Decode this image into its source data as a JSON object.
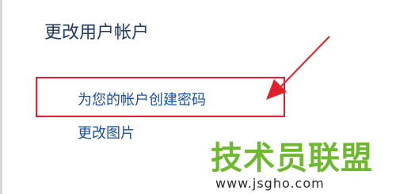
{
  "panel": {
    "title": "更改用户帐户"
  },
  "links": {
    "create_password": "为您的帐户创建密码",
    "change_picture": "更改图片"
  },
  "annotation": {
    "color": "#e0202a",
    "shape": "highlight-box-with-arrow"
  },
  "watermark": {
    "logo_text": "技术员联盟",
    "url": "www.jsgho.com",
    "logo_color": "#6eb830"
  }
}
